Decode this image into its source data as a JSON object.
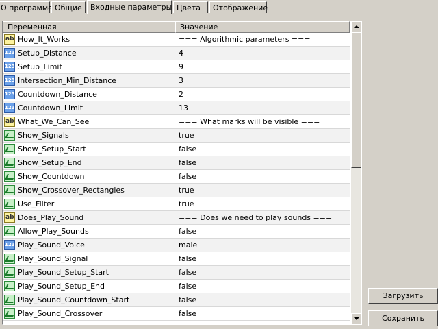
{
  "tabs": [
    {
      "label": "О программе",
      "active": false
    },
    {
      "label": "Общие",
      "active": false
    },
    {
      "label": "Входные параметры",
      "active": true
    },
    {
      "label": "Цвета",
      "active": false
    },
    {
      "label": "Отображение",
      "active": false
    }
  ],
  "table": {
    "headers": {
      "name": "Переменная",
      "value": "Значение"
    },
    "rows": [
      {
        "type": "string",
        "icon": "text-type-icon",
        "name": "How_It_Works",
        "value": "=== Algorithmic parameters ==="
      },
      {
        "type": "int",
        "icon": "integer-type-icon",
        "name": "Setup_Distance",
        "value": "4"
      },
      {
        "type": "int",
        "icon": "integer-type-icon",
        "name": "Setup_Limit",
        "value": "9"
      },
      {
        "type": "int",
        "icon": "integer-type-icon",
        "name": "Intersection_Min_Distance",
        "value": "3"
      },
      {
        "type": "int",
        "icon": "integer-type-icon",
        "name": "Countdown_Distance",
        "value": "2"
      },
      {
        "type": "int",
        "icon": "integer-type-icon",
        "name": "Countdown_Limit",
        "value": "13"
      },
      {
        "type": "string",
        "icon": "text-type-icon",
        "name": "What_We_Can_See",
        "value": "=== What marks will be visible ==="
      },
      {
        "type": "bool",
        "icon": "boolean-type-icon",
        "name": "Show_Signals",
        "value": "true"
      },
      {
        "type": "bool",
        "icon": "boolean-type-icon",
        "name": "Show_Setup_Start",
        "value": "false"
      },
      {
        "type": "bool",
        "icon": "boolean-type-icon",
        "name": "Show_Setup_End",
        "value": "false"
      },
      {
        "type": "bool",
        "icon": "boolean-type-icon",
        "name": "Show_Countdown",
        "value": "false"
      },
      {
        "type": "bool",
        "icon": "boolean-type-icon",
        "name": "Show_Crossover_Rectangles",
        "value": "true"
      },
      {
        "type": "bool",
        "icon": "boolean-type-icon",
        "name": "Use_Filter",
        "value": "true"
      },
      {
        "type": "string",
        "icon": "text-type-icon",
        "name": "Does_Play_Sound",
        "value": "=== Does we need to play sounds ==="
      },
      {
        "type": "bool",
        "icon": "boolean-type-icon",
        "name": "Allow_Play_Sounds",
        "value": "false"
      },
      {
        "type": "int",
        "icon": "integer-type-icon",
        "name": "Play_Sound_Voice",
        "value": "male"
      },
      {
        "type": "bool",
        "icon": "boolean-type-icon",
        "name": "Play_Sound_Signal",
        "value": "false"
      },
      {
        "type": "bool",
        "icon": "boolean-type-icon",
        "name": "Play_Sound_Setup_Start",
        "value": "false"
      },
      {
        "type": "bool",
        "icon": "boolean-type-icon",
        "name": "Play_Sound_Setup_End",
        "value": "false"
      },
      {
        "type": "bool",
        "icon": "boolean-type-icon",
        "name": "Play_Sound_Countdown_Start",
        "value": "false"
      },
      {
        "type": "bool",
        "icon": "boolean-type-icon",
        "name": "Play_Sound_Crossover",
        "value": "false"
      }
    ]
  },
  "buttons": {
    "load_label": "Загрузить",
    "save_label": "Сохранить"
  },
  "icons": {
    "scroll_up": "scroll-up-arrow-icon",
    "scroll_down": "scroll-down-arrow-icon"
  }
}
